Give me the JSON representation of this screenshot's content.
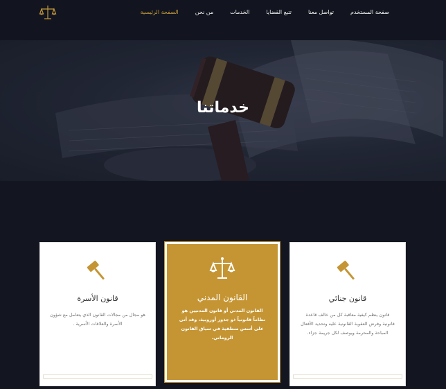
{
  "nav": {
    "items": [
      {
        "label": "الصفحة الرئيسية",
        "active": true
      },
      {
        "label": "من نحن"
      },
      {
        "label": "الخدمات"
      },
      {
        "label": "تتبع القضايا"
      },
      {
        "label": "تواصل معنا"
      },
      {
        "label": "صفحة المستخدم"
      }
    ]
  },
  "hero": {
    "title": "خدماتنا"
  },
  "services": {
    "cards": [
      {
        "title": "قانون جنائي",
        "text": "قانون ينظم كيفية معاقبة كل من خالف قاعدة قانونية وفرض العقوبة القانونية عليه وتحديد الأفعال المباحة والمحرمة ويوصف لكل جريمة جزاء.",
        "icon": "gavel-icon"
      },
      {
        "title": "القانون المدني",
        "text": "القانون المدني أو قانون المدنيين هو نظاماً قانونياً ذو جذور أوروبية، وقد أتى على أسس منطقية في سياق القانون الروماني.",
        "icon": "scales-icon"
      },
      {
        "title": "قانون الأسرة",
        "text": "هو مجال من مجالات القانون الذي يتعامل مع شؤون الأسرة والعلاقات الأسرية .",
        "icon": "gavel-icon"
      }
    ]
  },
  "colors": {
    "accent": "#c59534",
    "nav_bg": "#12151f",
    "page_bg": "#131620"
  }
}
